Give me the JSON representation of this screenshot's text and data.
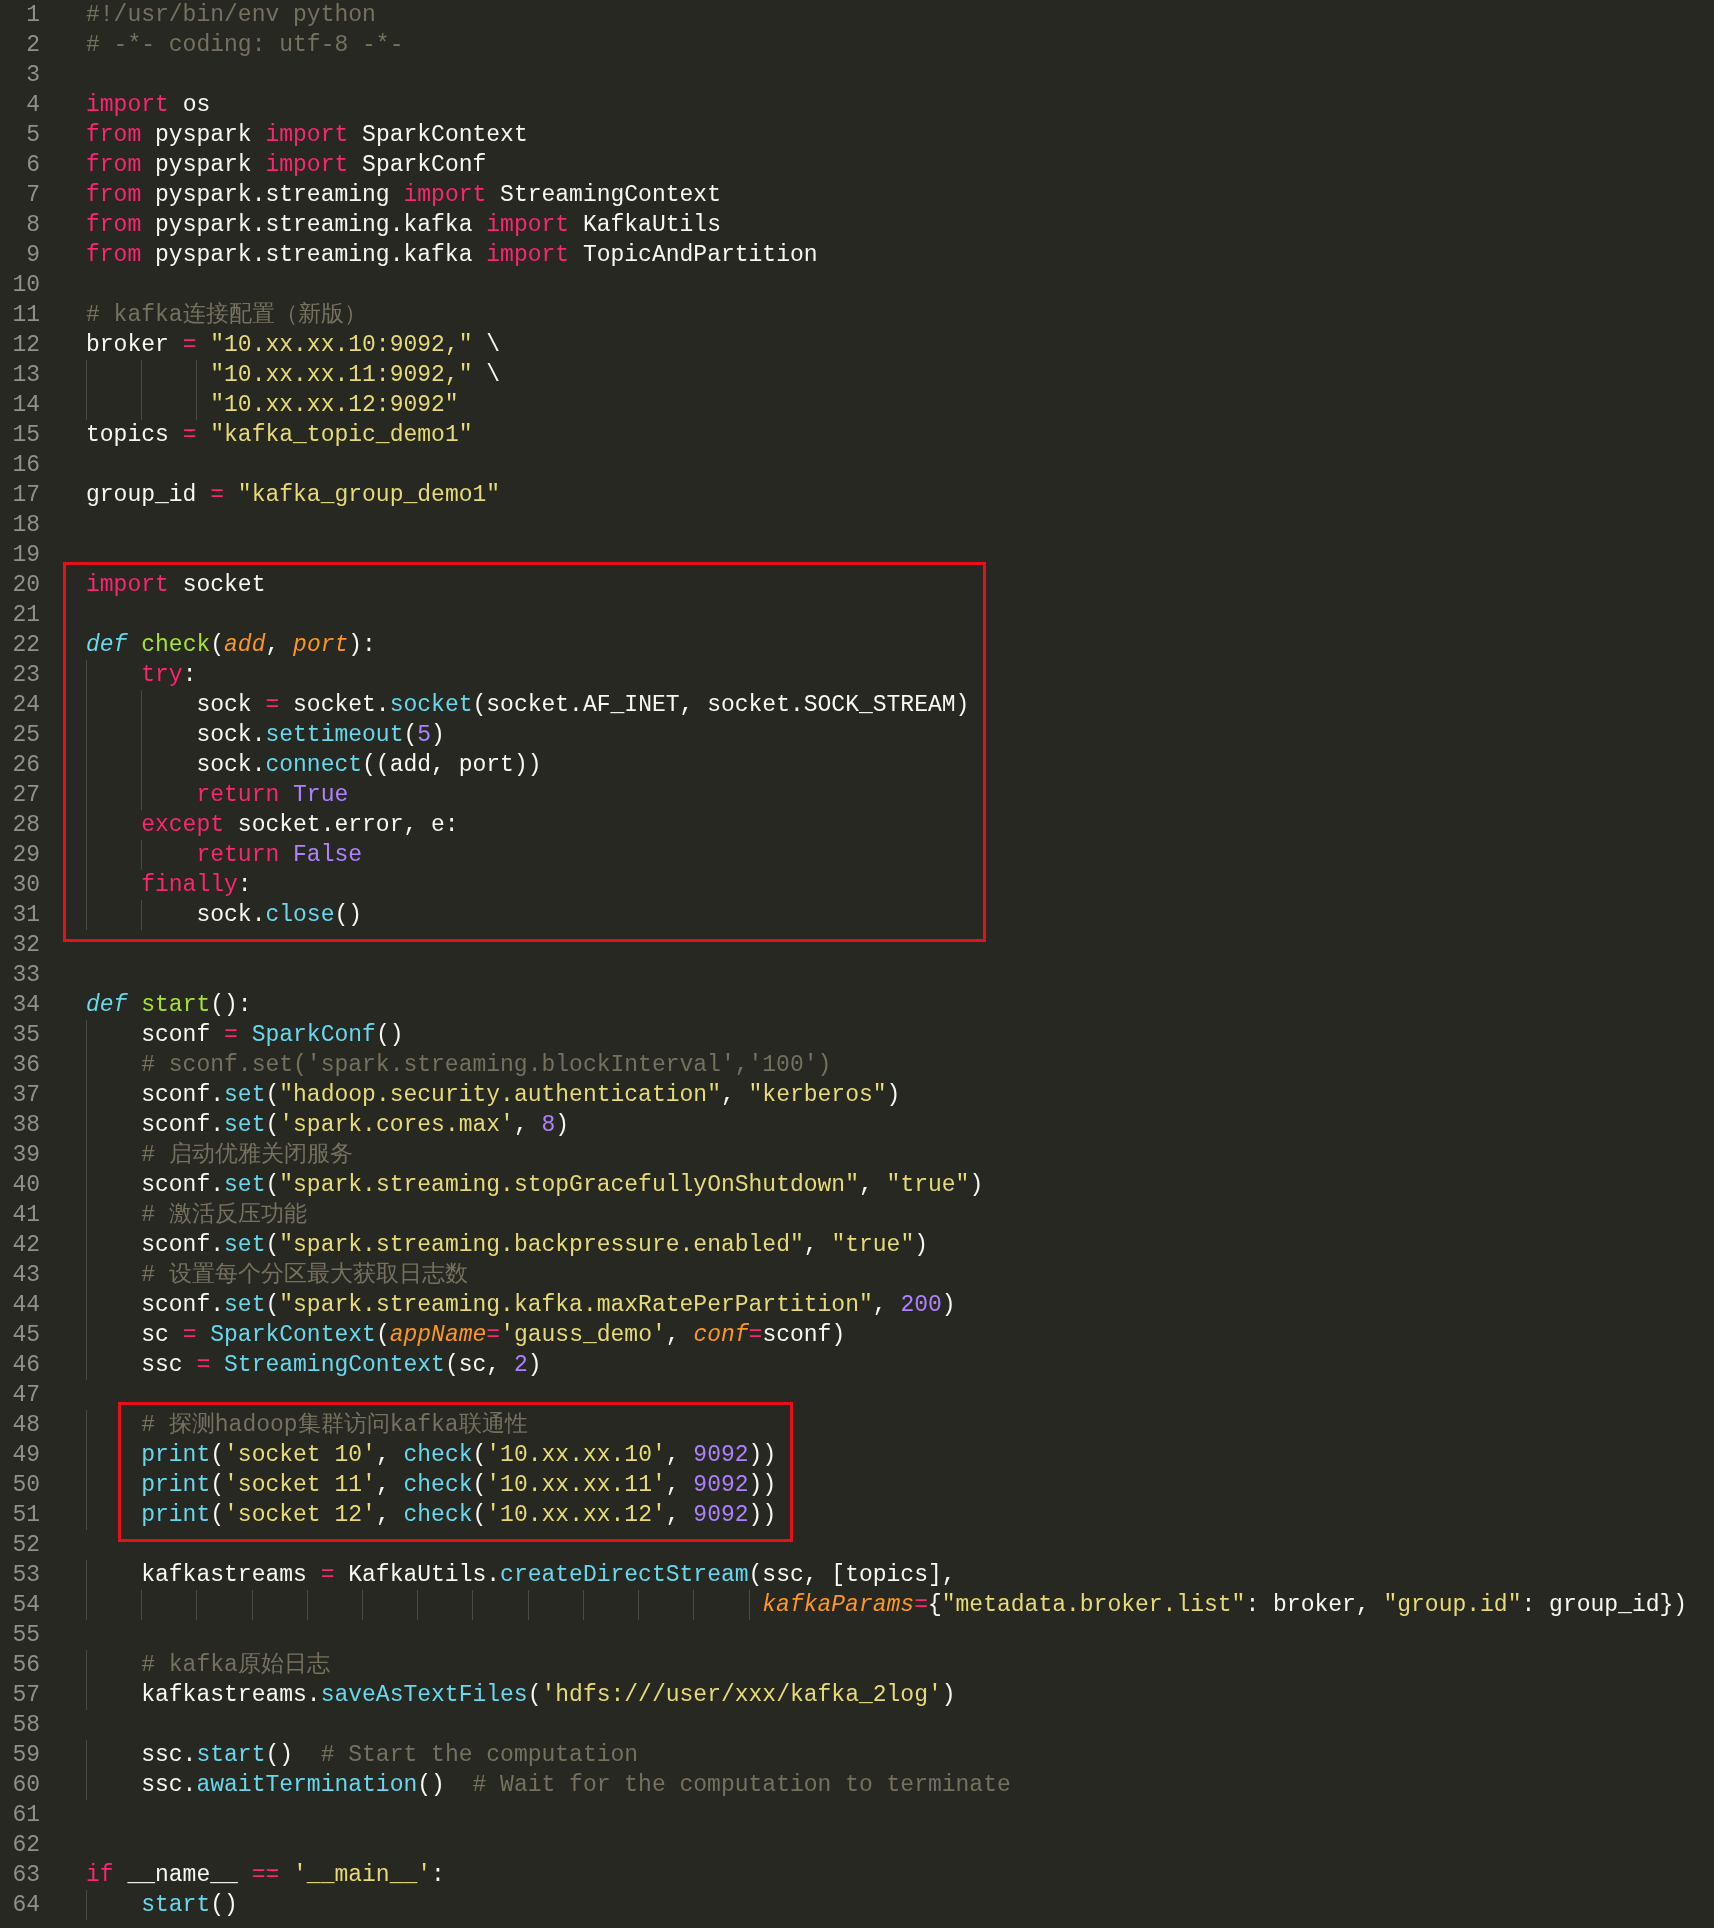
{
  "sections": [
    {
      "boxed": false,
      "lines": [
        {
          "number": "1",
          "tokens": [
            {
              "text": "#!/usr/bin/env python",
              "kind": "comment"
            }
          ]
        },
        {
          "number": "2",
          "tokens": [
            {
              "text": "# -*- coding: utf-8 -*-",
              "kind": "comment"
            }
          ]
        },
        {
          "number": "3"
        },
        {
          "number": "4",
          "tokens": [
            {
              "text": "import",
              "kind": "kw"
            },
            {
              "text": " os",
              "kind": "plain"
            }
          ]
        },
        {
          "number": "5",
          "tokens": [
            {
              "text": "from",
              "kind": "kw"
            },
            {
              "text": " pyspark ",
              "kind": "plain"
            },
            {
              "text": "import",
              "kind": "kw"
            },
            {
              "text": " SparkContext",
              "kind": "plain"
            }
          ]
        },
        {
          "number": "6",
          "tokens": [
            {
              "text": "from",
              "kind": "kw"
            },
            {
              "text": " pyspark ",
              "kind": "plain"
            },
            {
              "text": "import",
              "kind": "kw"
            },
            {
              "text": " SparkConf",
              "kind": "plain"
            }
          ]
        },
        {
          "number": "7",
          "tokens": [
            {
              "text": "from",
              "kind": "kw"
            },
            {
              "text": " pyspark.streaming ",
              "kind": "plain"
            },
            {
              "text": "import",
              "kind": "kw"
            },
            {
              "text": " StreamingContext",
              "kind": "plain"
            }
          ]
        },
        {
          "number": "8",
          "tokens": [
            {
              "text": "from",
              "kind": "kw"
            },
            {
              "text": " pyspark.streaming.kafka ",
              "kind": "plain"
            },
            {
              "text": "import",
              "kind": "kw"
            },
            {
              "text": " KafkaUtils",
              "kind": "plain"
            }
          ]
        },
        {
          "number": "9",
          "tokens": [
            {
              "text": "from",
              "kind": "kw"
            },
            {
              "text": " pyspark.streaming.kafka ",
              "kind": "plain"
            },
            {
              "text": "import",
              "kind": "kw"
            },
            {
              "text": " TopicAndPartition",
              "kind": "plain"
            }
          ]
        },
        {
          "number": "10"
        },
        {
          "number": "11",
          "tokens": [
            {
              "text": "# kafka连接配置（新版）",
              "kind": "comment"
            }
          ]
        },
        {
          "number": "12",
          "tokens": [
            {
              "text": "broker ",
              "kind": "plain"
            },
            {
              "text": "=",
              "kind": "kw"
            },
            {
              "text": " \"10.xx.xx.10:9092,\"",
              "kind": "str"
            },
            {
              "text": " \\",
              "kind": "plain"
            }
          ]
        },
        {
          "number": "13",
          "tokens": [
            {
              "text": "         \"10.xx.xx.11:9092,\"",
              "kind": "str"
            },
            {
              "text": " \\",
              "kind": "plain"
            }
          ]
        },
        {
          "number": "14",
          "tokens": [
            {
              "text": "         \"10.xx.xx.12:9092\"",
              "kind": "str"
            }
          ]
        },
        {
          "number": "15",
          "tokens": [
            {
              "text": "topics ",
              "kind": "plain"
            },
            {
              "text": "=",
              "kind": "kw"
            },
            {
              "text": " \"kafka_topic_demo1\"",
              "kind": "str"
            }
          ]
        },
        {
          "number": "16"
        },
        {
          "number": "17",
          "tokens": [
            {
              "text": "group_id ",
              "kind": "plain"
            },
            {
              "text": "=",
              "kind": "kw"
            },
            {
              "text": " \"kafka_group_demo1\"",
              "kind": "str"
            }
          ]
        },
        {
          "number": "18"
        },
        {
          "number": "19"
        }
      ]
    },
    {
      "boxed": true,
      "lines": [
        {
          "number": "20",
          "tokens": [
            {
              "text": "import",
              "kind": "kw"
            },
            {
              "text": " socket",
              "kind": "plain"
            }
          ]
        },
        {
          "number": "21"
        },
        {
          "number": "22",
          "tokens": [
            {
              "text": "def",
              "kind": "storage"
            },
            {
              "text": " check",
              "kind": "func"
            },
            {
              "text": "(",
              "kind": "plain"
            },
            {
              "text": "add",
              "kind": "param"
            },
            {
              "text": ", ",
              "kind": "plain"
            },
            {
              "text": "port",
              "kind": "param"
            },
            {
              "text": "):",
              "kind": "plain"
            }
          ]
        },
        {
          "number": "23",
          "tokens": [
            {
              "text": "    try",
              "kind": "kw"
            },
            {
              "text": ":",
              "kind": "plain"
            }
          ]
        },
        {
          "number": "24",
          "tokens": [
            {
              "text": "        sock ",
              "kind": "plain"
            },
            {
              "text": "=",
              "kind": "kw"
            },
            {
              "text": " socket.",
              "kind": "plain"
            },
            {
              "text": "socket",
              "kind": "call"
            },
            {
              "text": "(socket.AF_INET, socket.SOCK_STREAM)",
              "kind": "plain"
            }
          ]
        },
        {
          "number": "25",
          "tokens": [
            {
              "text": "        sock.",
              "kind": "plain"
            },
            {
              "text": "settimeout",
              "kind": "call"
            },
            {
              "text": "(",
              "kind": "plain"
            },
            {
              "text": "5",
              "kind": "num"
            },
            {
              "text": ")",
              "kind": "plain"
            }
          ]
        },
        {
          "number": "26",
          "tokens": [
            {
              "text": "        sock.",
              "kind": "plain"
            },
            {
              "text": "connect",
              "kind": "call"
            },
            {
              "text": "((add, port))",
              "kind": "plain"
            }
          ]
        },
        {
          "number": "27",
          "tokens": [
            {
              "text": "        return",
              "kind": "kw"
            },
            {
              "text": " True",
              "kind": "num"
            }
          ]
        },
        {
          "number": "28",
          "tokens": [
            {
              "text": "    except",
              "kind": "kw"
            },
            {
              "text": " socket.error, e:",
              "kind": "plain"
            }
          ]
        },
        {
          "number": "29",
          "tokens": [
            {
              "text": "        return",
              "kind": "kw"
            },
            {
              "text": " False",
              "kind": "num"
            }
          ]
        },
        {
          "number": "30",
          "tokens": [
            {
              "text": "    finally",
              "kind": "kw"
            },
            {
              "text": ":",
              "kind": "plain"
            }
          ]
        },
        {
          "number": "31",
          "tokens": [
            {
              "text": "        sock.",
              "kind": "plain"
            },
            {
              "text": "close",
              "kind": "call"
            },
            {
              "text": "()",
              "kind": "plain"
            }
          ]
        }
      ]
    },
    {
      "boxed": false,
      "lines": [
        {
          "number": "32"
        },
        {
          "number": "33"
        },
        {
          "number": "34",
          "tokens": [
            {
              "text": "def",
              "kind": "storage"
            },
            {
              "text": " start",
              "kind": "func"
            },
            {
              "text": "():",
              "kind": "plain"
            }
          ]
        },
        {
          "number": "35",
          "tokens": [
            {
              "text": "    sconf ",
              "kind": "plain"
            },
            {
              "text": "=",
              "kind": "kw"
            },
            {
              "text": " SparkConf",
              "kind": "call"
            },
            {
              "text": "()",
              "kind": "plain"
            }
          ]
        },
        {
          "number": "36",
          "tokens": [
            {
              "text": "    # sconf.set('spark.streaming.blockInterval','100')",
              "kind": "comment"
            }
          ]
        },
        {
          "number": "37",
          "tokens": [
            {
              "text": "    sconf.",
              "kind": "plain"
            },
            {
              "text": "set",
              "kind": "call"
            },
            {
              "text": "(",
              "kind": "plain"
            },
            {
              "text": "\"hadoop.security.authentication\"",
              "kind": "str"
            },
            {
              "text": ", ",
              "kind": "plain"
            },
            {
              "text": "\"kerberos\"",
              "kind": "str"
            },
            {
              "text": ")",
              "kind": "plain"
            }
          ]
        },
        {
          "number": "38",
          "tokens": [
            {
              "text": "    sconf.",
              "kind": "plain"
            },
            {
              "text": "set",
              "kind": "call"
            },
            {
              "text": "(",
              "kind": "plain"
            },
            {
              "text": "'spark.cores.max'",
              "kind": "str"
            },
            {
              "text": ", ",
              "kind": "plain"
            },
            {
              "text": "8",
              "kind": "num"
            },
            {
              "text": ")",
              "kind": "plain"
            }
          ]
        },
        {
          "number": "39",
          "tokens": [
            {
              "text": "    # 启动优雅关闭服务",
              "kind": "comment"
            }
          ]
        },
        {
          "number": "40",
          "tokens": [
            {
              "text": "    sconf.",
              "kind": "plain"
            },
            {
              "text": "set",
              "kind": "call"
            },
            {
              "text": "(",
              "kind": "plain"
            },
            {
              "text": "\"spark.streaming.stopGracefullyOnShutdown\"",
              "kind": "str"
            },
            {
              "text": ", ",
              "kind": "plain"
            },
            {
              "text": "\"true\"",
              "kind": "str"
            },
            {
              "text": ")",
              "kind": "plain"
            }
          ]
        },
        {
          "number": "41",
          "tokens": [
            {
              "text": "    # 激活反压功能",
              "kind": "comment"
            }
          ]
        },
        {
          "number": "42",
          "tokens": [
            {
              "text": "    sconf.",
              "kind": "plain"
            },
            {
              "text": "set",
              "kind": "call"
            },
            {
              "text": "(",
              "kind": "plain"
            },
            {
              "text": "\"spark.streaming.backpressure.enabled\"",
              "kind": "str"
            },
            {
              "text": ", ",
              "kind": "plain"
            },
            {
              "text": "\"true\"",
              "kind": "str"
            },
            {
              "text": ")",
              "kind": "plain"
            }
          ]
        },
        {
          "number": "43",
          "tokens": [
            {
              "text": "    # 设置每个分区最大获取日志数",
              "kind": "comment"
            }
          ]
        },
        {
          "number": "44",
          "tokens": [
            {
              "text": "    sconf.",
              "kind": "plain"
            },
            {
              "text": "set",
              "kind": "call"
            },
            {
              "text": "(",
              "kind": "plain"
            },
            {
              "text": "\"spark.streaming.kafka.maxRatePerPartition\"",
              "kind": "str"
            },
            {
              "text": ", ",
              "kind": "plain"
            },
            {
              "text": "200",
              "kind": "num"
            },
            {
              "text": ")",
              "kind": "plain"
            }
          ]
        },
        {
          "number": "45",
          "tokens": [
            {
              "text": "    sc ",
              "kind": "plain"
            },
            {
              "text": "=",
              "kind": "kw"
            },
            {
              "text": " SparkContext",
              "kind": "call"
            },
            {
              "text": "(",
              "kind": "plain"
            },
            {
              "text": "appName",
              "kind": "param"
            },
            {
              "text": "=",
              "kind": "kw"
            },
            {
              "text": "'gauss_demo'",
              "kind": "str"
            },
            {
              "text": ", ",
              "kind": "plain"
            },
            {
              "text": "conf",
              "kind": "param"
            },
            {
              "text": "=",
              "kind": "kw"
            },
            {
              "text": "sconf)",
              "kind": "plain"
            }
          ]
        },
        {
          "number": "46",
          "tokens": [
            {
              "text": "    ssc ",
              "kind": "plain"
            },
            {
              "text": "=",
              "kind": "kw"
            },
            {
              "text": " StreamingContext",
              "kind": "call"
            },
            {
              "text": "(sc, ",
              "kind": "plain"
            },
            {
              "text": "2",
              "kind": "num"
            },
            {
              "text": ")",
              "kind": "plain"
            }
          ]
        },
        {
          "number": "47"
        }
      ]
    },
    {
      "boxed": true,
      "lines": [
        {
          "number": "48",
          "tokens": [
            {
              "text": "    # 探测hadoop集群访问kafka联通性",
              "kind": "comment"
            }
          ]
        },
        {
          "number": "49",
          "tokens": [
            {
              "text": "    print",
              "kind": "call"
            },
            {
              "text": "(",
              "kind": "plain"
            },
            {
              "text": "'socket 10'",
              "kind": "str"
            },
            {
              "text": ", ",
              "kind": "plain"
            },
            {
              "text": "check",
              "kind": "call"
            },
            {
              "text": "(",
              "kind": "plain"
            },
            {
              "text": "'10.xx.xx.10'",
              "kind": "str"
            },
            {
              "text": ", ",
              "kind": "plain"
            },
            {
              "text": "9092",
              "kind": "num"
            },
            {
              "text": "))",
              "kind": "plain"
            }
          ]
        },
        {
          "number": "50",
          "tokens": [
            {
              "text": "    print",
              "kind": "call"
            },
            {
              "text": "(",
              "kind": "plain"
            },
            {
              "text": "'socket 11'",
              "kind": "str"
            },
            {
              "text": ", ",
              "kind": "plain"
            },
            {
              "text": "check",
              "kind": "call"
            },
            {
              "text": "(",
              "kind": "plain"
            },
            {
              "text": "'10.xx.xx.11'",
              "kind": "str"
            },
            {
              "text": ", ",
              "kind": "plain"
            },
            {
              "text": "9092",
              "kind": "num"
            },
            {
              "text": "))",
              "kind": "plain"
            }
          ]
        },
        {
          "number": "51",
          "tokens": [
            {
              "text": "    print",
              "kind": "call"
            },
            {
              "text": "(",
              "kind": "plain"
            },
            {
              "text": "'socket 12'",
              "kind": "str"
            },
            {
              "text": ", ",
              "kind": "plain"
            },
            {
              "text": "check",
              "kind": "call"
            },
            {
              "text": "(",
              "kind": "plain"
            },
            {
              "text": "'10.xx.xx.12'",
              "kind": "str"
            },
            {
              "text": ", ",
              "kind": "plain"
            },
            {
              "text": "9092",
              "kind": "num"
            },
            {
              "text": "))",
              "kind": "plain"
            }
          ]
        }
      ]
    },
    {
      "boxed": false,
      "lines": [
        {
          "number": "52"
        },
        {
          "number": "53",
          "tokens": [
            {
              "text": "    kafkastreams ",
              "kind": "plain"
            },
            {
              "text": "=",
              "kind": "kw"
            },
            {
              "text": " KafkaUtils.",
              "kind": "plain"
            },
            {
              "text": "createDirectStream",
              "kind": "call"
            },
            {
              "text": "(ssc, [topics],",
              "kind": "plain"
            }
          ]
        },
        {
          "number": "54",
          "tokens": [
            {
              "text": "                                                 kafkaParams",
              "kind": "param"
            },
            {
              "text": "=",
              "kind": "kw"
            },
            {
              "text": "{",
              "kind": "plain"
            },
            {
              "text": "\"metadata.broker.list\"",
              "kind": "str"
            },
            {
              "text": ": broker, ",
              "kind": "plain"
            },
            {
              "text": "\"group.id\"",
              "kind": "str"
            },
            {
              "text": ": group_id})",
              "kind": "plain"
            }
          ]
        },
        {
          "number": "55"
        },
        {
          "number": "56",
          "tokens": [
            {
              "text": "    # kafka原始日志",
              "kind": "comment"
            }
          ]
        },
        {
          "number": "57",
          "tokens": [
            {
              "text": "    kafkastreams.",
              "kind": "plain"
            },
            {
              "text": "saveAsTextFiles",
              "kind": "call"
            },
            {
              "text": "(",
              "kind": "plain"
            },
            {
              "text": "'hdfs:///user/xxx/kafka_2log'",
              "kind": "str"
            },
            {
              "text": ")",
              "kind": "plain"
            }
          ]
        },
        {
          "number": "58"
        },
        {
          "number": "59",
          "tokens": [
            {
              "text": "    ssc.",
              "kind": "plain"
            },
            {
              "text": "start",
              "kind": "call"
            },
            {
              "text": "()  ",
              "kind": "plain"
            },
            {
              "text": "# Start the computation",
              "kind": "comment"
            }
          ]
        },
        {
          "number": "60",
          "tokens": [
            {
              "text": "    ssc.",
              "kind": "plain"
            },
            {
              "text": "awaitTermination",
              "kind": "call"
            },
            {
              "text": "()  ",
              "kind": "plain"
            },
            {
              "text": "# Wait for the computation to terminate",
              "kind": "comment"
            }
          ]
        },
        {
          "number": "61"
        },
        {
          "number": "62"
        },
        {
          "number": "63",
          "tokens": [
            {
              "text": "if",
              "kind": "kw"
            },
            {
              "text": " __name__ ",
              "kind": "plain"
            },
            {
              "text": "==",
              "kind": "kw"
            },
            {
              "text": " '__main__'",
              "kind": "str"
            },
            {
              "text": ":",
              "kind": "plain"
            }
          ]
        },
        {
          "number": "64",
          "tokens": [
            {
              "text": "    start",
              "kind": "call"
            },
            {
              "text": "()",
              "kind": "plain"
            }
          ]
        }
      ]
    }
  ]
}
